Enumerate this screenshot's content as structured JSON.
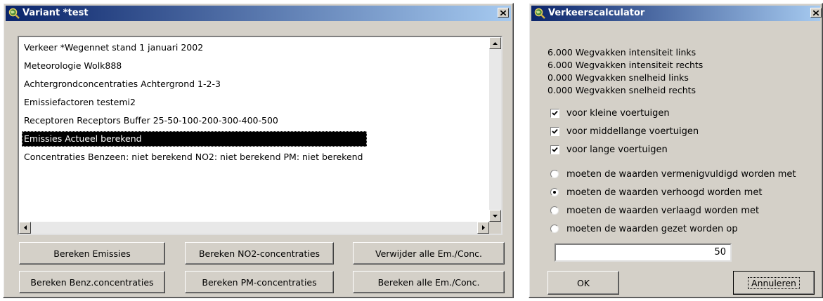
{
  "variant_window": {
    "title": "Variant *test",
    "list_items": [
      "Verkeer *Wegennet stand 1 januari 2002",
      "Meteorologie Wolk888",
      "Achtergrondconcentraties Achtergrond 1-2-3",
      "Emissiefactoren testemi2",
      "Receptoren Receptors Buffer 25-50-100-200-300-400-500",
      "Emissies Actueel berekend",
      "Concentraties Benzeen: niet berekend NO2: niet berekend PM: niet berekend"
    ],
    "selected_item": "Emissies Actueel berekend",
    "buttons": {
      "bereken_emissies": "Bereken Emissies",
      "bereken_no2": "Bereken NO2-concentraties",
      "verwijder_alle": "Verwijder alle Em./Conc.",
      "bereken_benz": "Bereken Benz.concentraties",
      "bereken_pm": "Bereken PM-concentraties",
      "bereken_alle": "Bereken alle Em./Conc."
    }
  },
  "calc_window": {
    "title": "Verkeerscalculator",
    "info_lines": [
      "6.000 Wegvakken intensiteit links",
      "6.000 Wegvakken intensiteit rechts",
      "0.000 Wegvakken snelheid links",
      "0.000 Wegvakken snelheid rechts"
    ],
    "checkboxes": [
      {
        "label": "voor kleine voertuigen",
        "checked": true
      },
      {
        "label": "voor middellange voertuigen",
        "checked": true
      },
      {
        "label": "voor lange voertuigen",
        "checked": true
      }
    ],
    "radios": [
      {
        "label": "moeten de waarden vermenigvuldigd worden met",
        "selected": false
      },
      {
        "label": "moeten de waarden verhoogd worden met",
        "selected": true
      },
      {
        "label": "moeten de waarden verlaagd worden met",
        "selected": false
      },
      {
        "label": "moeten de waarden gezet worden op",
        "selected": false
      }
    ],
    "value": "50",
    "ok_label": "OK",
    "cancel_label": "Annuleren"
  },
  "icons": {
    "app_icon": "magnifier-globe-icon",
    "close_icon": "close-x-icon",
    "scroll_up": "triangle-up-icon",
    "scroll_down": "triangle-down-icon",
    "scroll_left": "triangle-left-icon",
    "scroll_right": "triangle-right-icon"
  },
  "colors": {
    "titlebar_start": "#0a246a",
    "titlebar_end": "#a6caf0",
    "window_face": "#d4d0c8",
    "selection": "#000000"
  }
}
